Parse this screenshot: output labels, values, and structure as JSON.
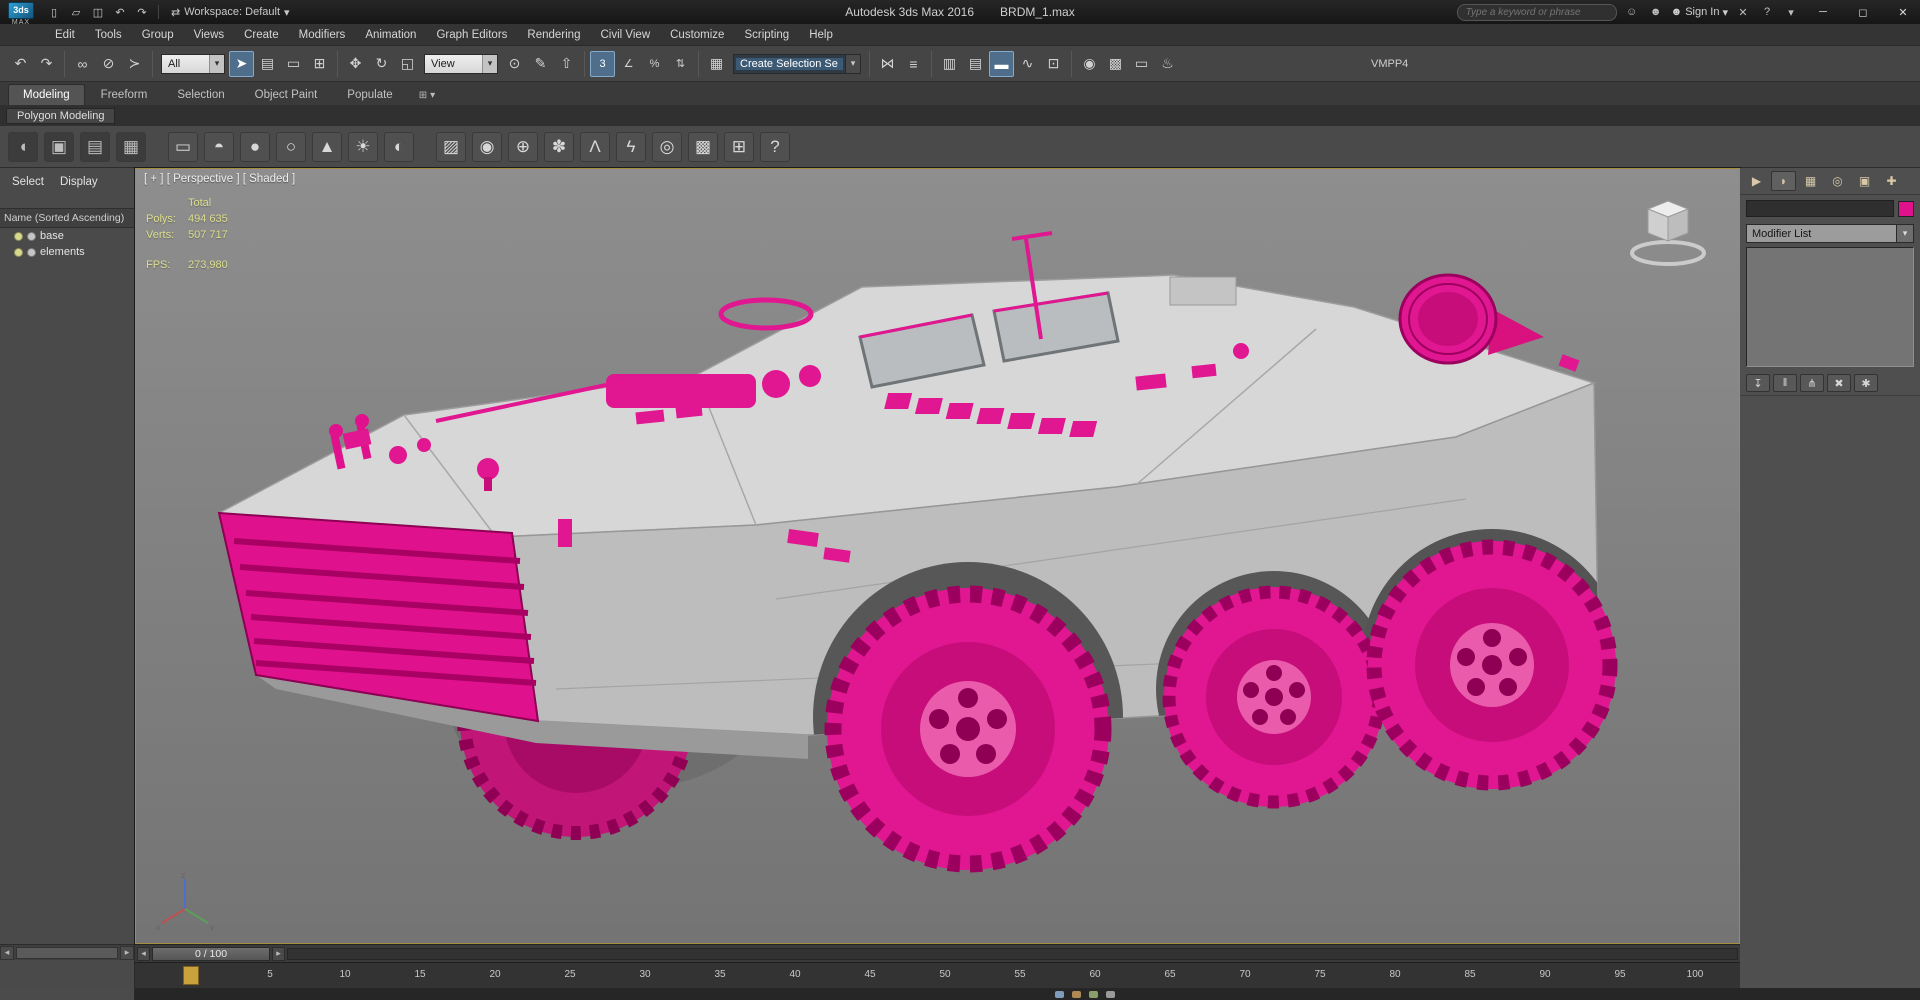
{
  "colors": {
    "accent_pink": "#e0118c",
    "highlight_blue": "#4f6e8c",
    "marker_yellow": "#c9a23d"
  },
  "title_bar": {
    "app_title": "Autodesk 3ds Max 2016",
    "file_name": "BRDM_1.max",
    "workspace_label": "Workspace: Default",
    "search_placeholder": "Type a keyword or phrase",
    "sign_in_label": "Sign In",
    "logo_text": "MAX",
    "logo_mark": "3ds"
  },
  "menu_bar": {
    "items": [
      "Edit",
      "Tools",
      "Group",
      "Views",
      "Create",
      "Modifiers",
      "Animation",
      "Graph Editors",
      "Rendering",
      "Civil View",
      "Customize",
      "Scripting",
      "Help"
    ]
  },
  "toolbar": {
    "selection_filter_value": "All",
    "ref_coord_value": "View",
    "named_selection_placeholder": "Create Selection Se",
    "right_label": "VMPP4"
  },
  "ribbon": {
    "tabs": [
      "Modeling",
      "Freeform",
      "Selection",
      "Object Paint",
      "Populate"
    ],
    "active_tab": "Modeling",
    "panel_label": "Polygon Modeling"
  },
  "scene_explorer": {
    "tabs": [
      "Select",
      "Display"
    ],
    "header": "Name (Sorted Ascending)",
    "items": [
      {
        "label": "base"
      },
      {
        "label": "elements"
      }
    ]
  },
  "viewport": {
    "label": "[ + ] [ Perspective ] [ Shaded ]",
    "stats": {
      "total_label": "Total",
      "polys_label": "Polys:",
      "polys_value": "494 635",
      "verts_label": "Verts:",
      "verts_value": "507 717",
      "fps_label": "FPS:",
      "fps_value": "273,980"
    }
  },
  "command_panel": {
    "modifier_list_label": "Modifier List"
  },
  "timeline": {
    "frame_display": "0 / 100",
    "start_frame": "0",
    "end_frame": "100",
    "ticks": [
      5,
      10,
      15,
      20,
      25,
      30,
      35,
      40,
      45,
      50,
      55,
      60,
      65,
      70,
      75,
      80,
      85,
      90,
      95,
      100
    ]
  },
  "icons": {
    "new": "▯",
    "open": "▱",
    "save": "◫",
    "undo": "↶",
    "redo": "↷",
    "ws-arrows": "⇄",
    "caret-down": "▾",
    "caret-left": "◂",
    "caret-right": "▸",
    "link": "∞",
    "unlink": "⊘",
    "bind": "≻",
    "select": "➤",
    "select-by-name": "▤",
    "region": "▭",
    "window-crossing": "⊞",
    "move": "✥",
    "rotate": "↻",
    "scale": "◱",
    "pivot": "⊙",
    "manipulate": "✎",
    "kbd-override": "⇧",
    "snap-3d": "3",
    "snap-angle": "∠",
    "snap-percent": "%",
    "snap-spinner": "⇅",
    "edit-sel-sets": "▦",
    "mirror": "⋈",
    "align": "≡",
    "scene-explorer": "▥",
    "layer-explorer": "▤",
    "ribbon-toggle": "▬",
    "curve-editor": "∿",
    "schematic": "⊡",
    "material-editor": "◉",
    "render-setup": "▩",
    "rendered-frame": "▭",
    "render": "♨",
    "community": "☺",
    "profile": "☻",
    "session-close": "✕",
    "help": "?",
    "minimize": "─",
    "maximize": "◻",
    "close": "✕",
    "tab-create": "▶",
    "tab-modify": "◗",
    "tab-hierarchy": "▦",
    "tab-motion": "◎",
    "tab-display": "▣",
    "tab-utilities": "✚",
    "pin-stack": "↧",
    "show-end-result": "‖",
    "make-unique": "⋔",
    "remove-modifier": "✖",
    "configure-sets": "✱",
    "m-flyout": "◖",
    "m-display": "▣",
    "m-grid1": "▤",
    "m-grid2": "▦",
    "m-box": "▭",
    "m-dome": "◓",
    "m-sphere": "●",
    "m-ring": "○",
    "m-cone": "▲",
    "m-sun": "☀",
    "m-shaded": "◐",
    "m-hatch": "▨",
    "m-ball": "◉",
    "m-gyro": "⊕",
    "m-foliage": "✽",
    "m-bones": "Λ",
    "m-lightning": "ϟ",
    "m-orb": "◎",
    "m-array": "▩",
    "m-container": "⊞",
    "m-help": "?"
  }
}
